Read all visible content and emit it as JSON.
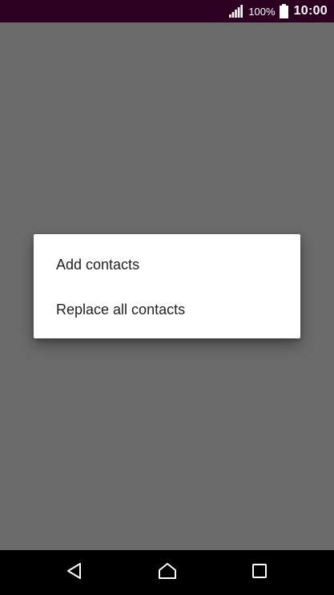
{
  "status_bar": {
    "battery_percent": "100%",
    "time": "10:00",
    "icons": [
      "signal-icon",
      "battery-icon"
    ]
  },
  "dialog": {
    "options": [
      {
        "label": "Add contacts"
      },
      {
        "label": "Replace all contacts"
      }
    ]
  },
  "nav_bar": {
    "icons": [
      "back-icon",
      "home-icon",
      "recent-apps-icon"
    ]
  },
  "colors": {
    "status_bar_bg": "#2d0022",
    "scrim": "#6b6b6b",
    "dialog_bg": "#ffffff",
    "nav_bar_bg": "#000000"
  }
}
